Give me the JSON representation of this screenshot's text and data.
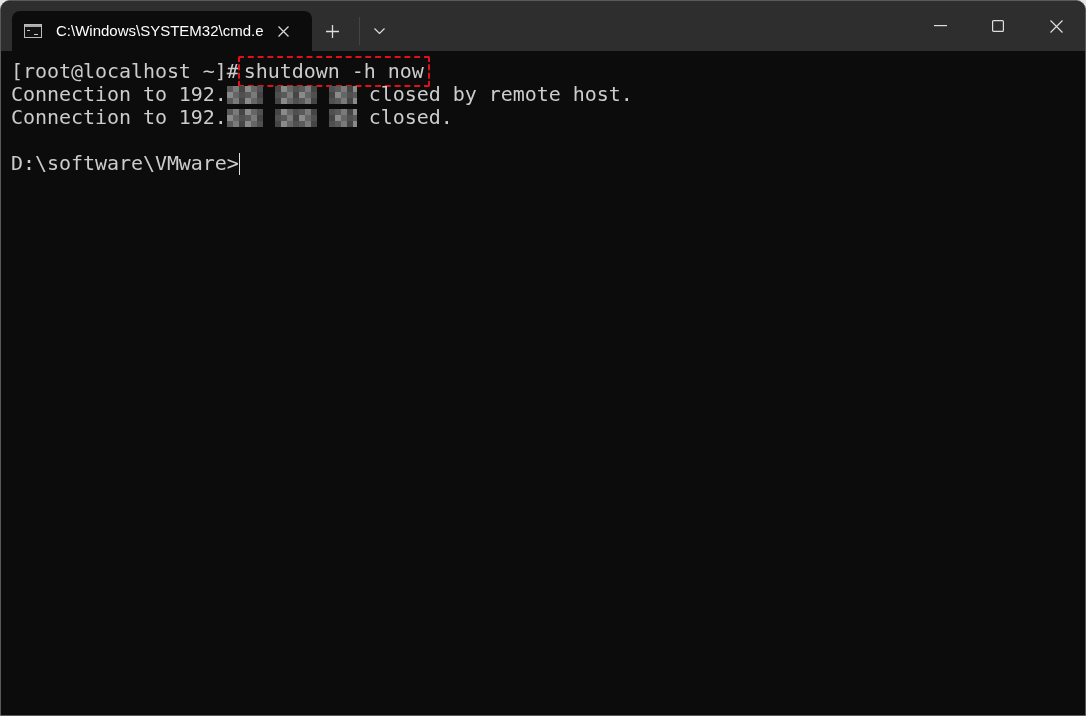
{
  "window": {
    "tab": {
      "title": "C:\\Windows\\SYSTEM32\\cmd.e",
      "selected": true
    }
  },
  "terminal": {
    "lines": [
      {
        "kind": "command",
        "prompt": "[root@localhost ~]#",
        "command": "shutdown -h now",
        "highlighted": true
      },
      {
        "kind": "redacted",
        "before": "Connection to 192.",
        "after": " closed by remote host."
      },
      {
        "kind": "redacted",
        "before": "Connection to 192.",
        "after": " closed."
      },
      {
        "kind": "blank"
      },
      {
        "kind": "prompt",
        "prompt": "D:\\software\\VMware>",
        "cursor": true
      }
    ]
  }
}
